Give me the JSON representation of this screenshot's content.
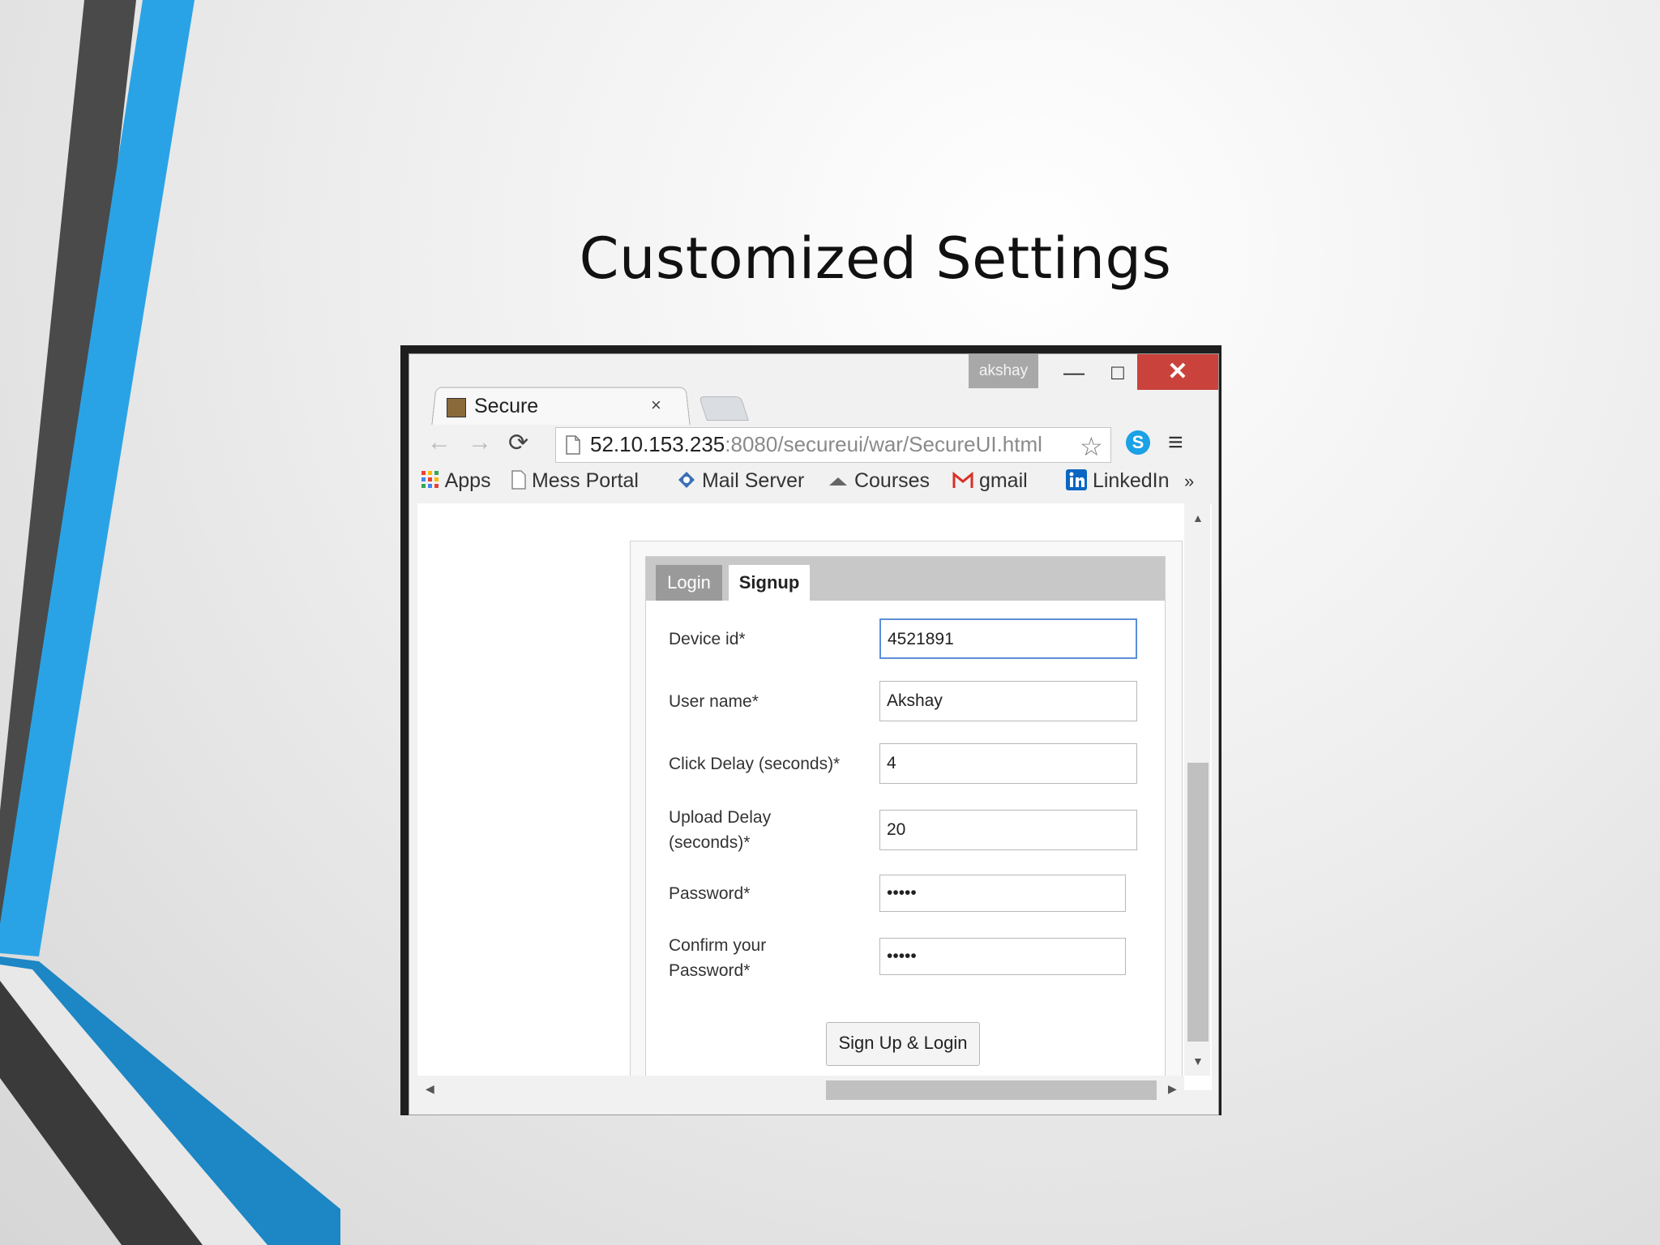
{
  "slide": {
    "title": "Customized Settings"
  },
  "window": {
    "user": "akshay",
    "minimize": "—",
    "maximize": "□",
    "close": "✕"
  },
  "tab": {
    "title": "Secure",
    "close": "×",
    "favicon": "page-favicon"
  },
  "toolbar": {
    "back": "←",
    "forward": "→",
    "reload": "⟳",
    "url_host": "52.10.153.235",
    "url_path": ":8080/secureui/war/SecureUI.html",
    "star": "☆",
    "skype": "S",
    "menu": "≡"
  },
  "bookmarks": [
    {
      "label": "Apps",
      "icon": "apps-grid-icon"
    },
    {
      "label": "Mess Portal",
      "icon": "page-icon"
    },
    {
      "label": "Mail Server",
      "icon": "mail-icon"
    },
    {
      "label": "Courses",
      "icon": "cloud-icon"
    },
    {
      "label": "gmail",
      "icon": "gmail-icon"
    },
    {
      "label": "LinkedIn",
      "icon": "linkedin-icon"
    }
  ],
  "bookmarks_more": "»",
  "form": {
    "tabs": {
      "login": "Login",
      "signup": "Signup"
    },
    "fields": {
      "device_id": {
        "label": "Device id*",
        "value": "4521891"
      },
      "user_name": {
        "label": "User name*",
        "value": "Akshay"
      },
      "click_delay": {
        "label": "Click Delay (seconds)*",
        "value": "4"
      },
      "upload_delay": {
        "label_line1": "Upload Delay",
        "label_line2": "(seconds)*",
        "value": "20"
      },
      "password": {
        "label": "Password*",
        "value": "•••••"
      },
      "confirm_password": {
        "label_line1": "Confirm your",
        "label_line2": "Password*",
        "value": "•••••"
      }
    },
    "submit_label": "Sign Up & Login"
  },
  "colors": {
    "accent_blue": "#29a3e6",
    "dark_stripe": "#3b3b3b",
    "close_red": "#c9433c"
  }
}
